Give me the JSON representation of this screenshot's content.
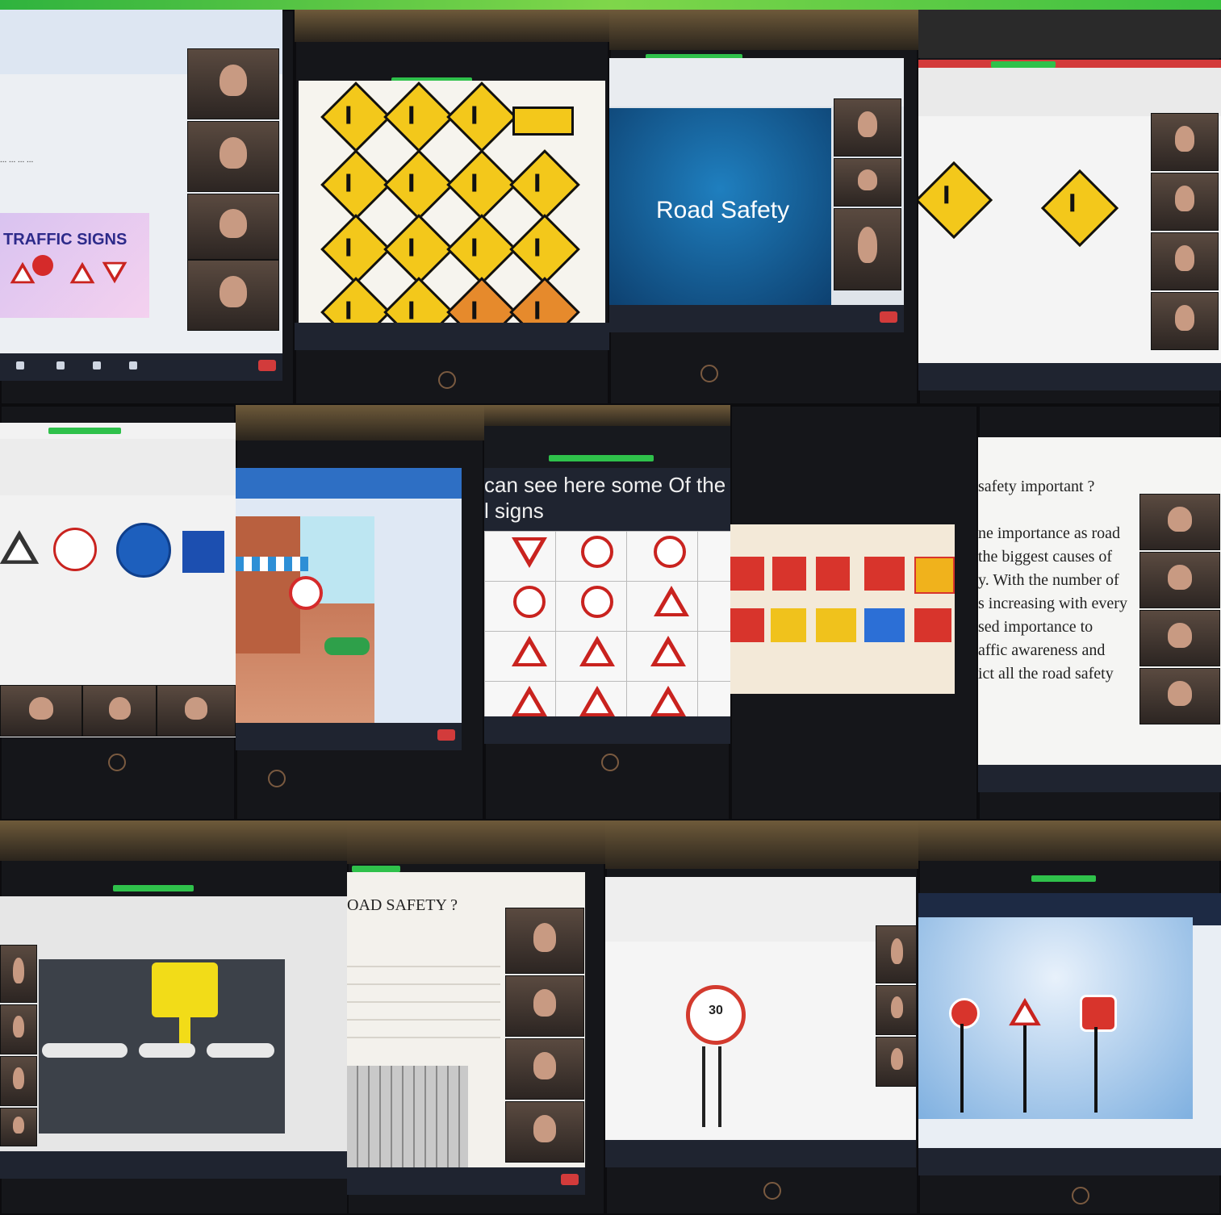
{
  "collage": {
    "road_safety_title": "Road Safety",
    "traffic_signs_title": "TRAFFIC SIGNS",
    "signs_intro_line1": "can see here some Of the",
    "signs_intro_line2": "l signs",
    "road_safety_question": "safety important ?",
    "body_lines": [
      "ne importance as road",
      "the biggest causes of",
      "y. With the number of",
      "s increasing with every",
      "sed importance to",
      "affic awareness and",
      "ict all the road safety"
    ],
    "road_safety_heading2": "OAD SAFETY ?",
    "speed_sign": "30"
  },
  "colors": {
    "accent_green": "#2fc14b",
    "sign_yellow": "#f3c81b",
    "sign_red": "#c9231f",
    "slide_blue": "#0d5e9c"
  }
}
